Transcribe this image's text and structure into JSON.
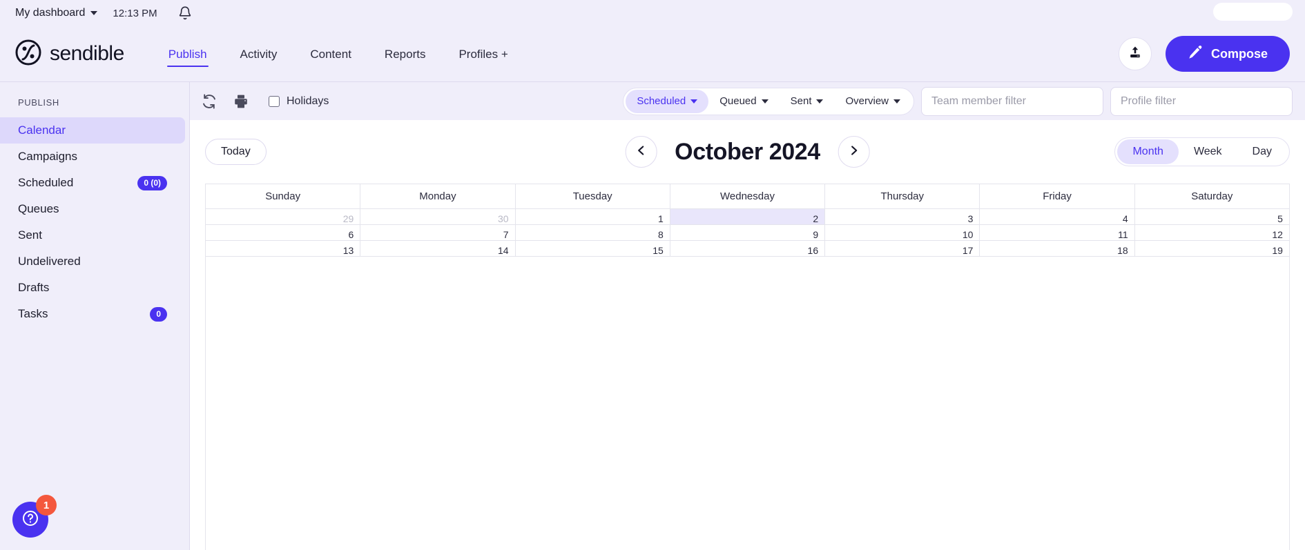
{
  "topbar": {
    "dashboard_label": "My dashboard",
    "time": "12:13 PM",
    "bell_icon": "bell-icon",
    "caret_icon": "chevron-down-icon"
  },
  "header": {
    "brand": "sendible",
    "nav": [
      {
        "label": "Publish",
        "active": true
      },
      {
        "label": "Activity",
        "active": false
      },
      {
        "label": "Content",
        "active": false
      },
      {
        "label": "Reports",
        "active": false
      },
      {
        "label": "Profiles +",
        "active": false
      }
    ],
    "upload_icon": "upload-icon",
    "compose_label": "Compose",
    "compose_icon": "pencil-icon",
    "accent": "#4a32f0"
  },
  "sidebar": {
    "heading": "PUBLISH",
    "items": [
      {
        "label": "Calendar",
        "badge": null,
        "active": true
      },
      {
        "label": "Campaigns",
        "badge": null,
        "active": false
      },
      {
        "label": "Scheduled",
        "badge": "0 (0)",
        "active": false
      },
      {
        "label": "Queues",
        "badge": null,
        "active": false
      },
      {
        "label": "Sent",
        "badge": null,
        "active": false
      },
      {
        "label": "Undelivered",
        "badge": null,
        "active": false
      },
      {
        "label": "Drafts",
        "badge": null,
        "active": false
      },
      {
        "label": "Tasks",
        "badge": "0",
        "active": false
      }
    ],
    "help": {
      "icon": "question-mark-icon",
      "badge": "1",
      "badge_color": "#f4573d"
    }
  },
  "filterbar": {
    "refresh_icon": "refresh-icon",
    "print_icon": "print-icon",
    "holidays_label": "Holidays",
    "holidays_checked": false,
    "segments": [
      {
        "label": "Scheduled",
        "active": true,
        "caret": true
      },
      {
        "label": "Queued",
        "active": false,
        "caret": true
      },
      {
        "label": "Sent",
        "active": false,
        "caret": true
      },
      {
        "label": "Overview",
        "active": false,
        "caret": true
      }
    ],
    "team_filter_placeholder": "Team member filter",
    "team_filter_value": "",
    "profile_filter_placeholder": "Profile filter",
    "profile_filter_value": ""
  },
  "calendar": {
    "today_label": "Today",
    "title": "October 2024",
    "prev_icon": "chevron-left-icon",
    "next_icon": "chevron-right-icon",
    "views": [
      {
        "label": "Month",
        "active": true
      },
      {
        "label": "Week",
        "active": false
      },
      {
        "label": "Day",
        "active": false
      }
    ],
    "day_names": [
      "Sunday",
      "Monday",
      "Tuesday",
      "Wednesday",
      "Thursday",
      "Friday",
      "Saturday"
    ],
    "weeks": [
      [
        {
          "n": "29",
          "other": true,
          "today": false
        },
        {
          "n": "30",
          "other": true,
          "today": false
        },
        {
          "n": "1",
          "other": false,
          "today": false
        },
        {
          "n": "2",
          "other": false,
          "today": true
        },
        {
          "n": "3",
          "other": false,
          "today": false
        },
        {
          "n": "4",
          "other": false,
          "today": false
        },
        {
          "n": "5",
          "other": false,
          "today": false
        }
      ],
      [
        {
          "n": "6",
          "other": false,
          "today": false
        },
        {
          "n": "7",
          "other": false,
          "today": false
        },
        {
          "n": "8",
          "other": false,
          "today": false
        },
        {
          "n": "9",
          "other": false,
          "today": false
        },
        {
          "n": "10",
          "other": false,
          "today": false
        },
        {
          "n": "11",
          "other": false,
          "today": false
        },
        {
          "n": "12",
          "other": false,
          "today": false
        }
      ],
      [
        {
          "n": "13",
          "other": false,
          "today": false
        },
        {
          "n": "14",
          "other": false,
          "today": false
        },
        {
          "n": "15",
          "other": false,
          "today": false
        },
        {
          "n": "16",
          "other": false,
          "today": false
        },
        {
          "n": "17",
          "other": false,
          "today": false
        },
        {
          "n": "18",
          "other": false,
          "today": false
        },
        {
          "n": "19",
          "other": false,
          "today": false
        }
      ]
    ]
  }
}
